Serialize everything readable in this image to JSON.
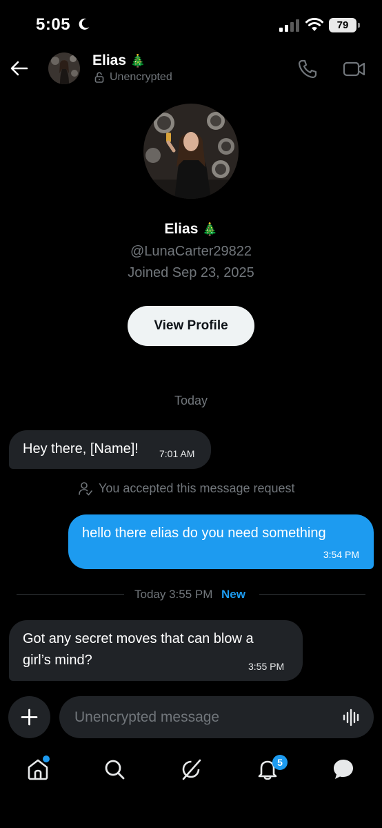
{
  "status_bar": {
    "time": "5:05",
    "battery": "79"
  },
  "header": {
    "name": "Elias",
    "name_emoji": "🎄",
    "subtitle": "Unencrypted"
  },
  "profile": {
    "name": "Elias",
    "name_emoji": "🎄",
    "handle": "@LunaCarter29822",
    "joined": "Joined Sep 23, 2025",
    "view_profile_label": "View Profile"
  },
  "conversation": {
    "day_label": "Today",
    "messages": [
      {
        "direction": "incoming",
        "text": "Hey there, [Name]!",
        "time": "7:01 AM"
      },
      {
        "direction": "outgoing",
        "text": "hello there elias do you need something",
        "time": "3:54 PM"
      },
      {
        "direction": "incoming",
        "line1": "Got any secret moves that can blow a",
        "line2": "girl’s mind?",
        "time": "3:55 PM"
      }
    ],
    "request_notice": "You accepted this message request",
    "divider_text": "Today 3:55 PM",
    "divider_new": "New"
  },
  "composer": {
    "placeholder": "Unencrypted message"
  },
  "nav": {
    "notifications_badge": "5",
    "icons": [
      "home-icon",
      "search-icon",
      "grok-icon",
      "notifications-icon",
      "messages-icon"
    ]
  },
  "colors": {
    "accent": "#1d9bf0",
    "background": "#000000",
    "bubble_incoming": "#202327",
    "muted_text": "#71767b"
  }
}
